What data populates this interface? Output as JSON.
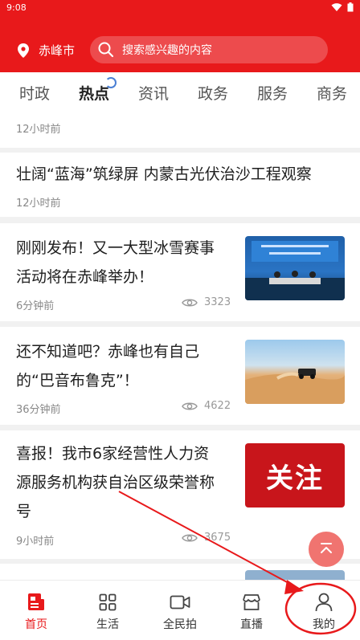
{
  "status_bar": {
    "time": "9:08"
  },
  "header": {
    "city": "赤峰市",
    "search_placeholder": "搜索感兴趣的内容"
  },
  "tabs": [
    {
      "label": "时政"
    },
    {
      "label": "热点"
    },
    {
      "label": "资讯"
    },
    {
      "label": "政务"
    },
    {
      "label": "服务"
    },
    {
      "label": "商务"
    }
  ],
  "active_tab": "热点",
  "feed": [
    {
      "title": "",
      "time": "12小时前"
    },
    {
      "title": "壮阔“蓝海”筑绿屏 内蒙古光伏治沙工程观察",
      "time": "12小时前"
    },
    {
      "title_line1": "刚刚发布！又一大型冰雪赛事",
      "title_line2": "活动将在赤峰举办！",
      "time": "6分钟前",
      "views": "3323",
      "image": "conference-photo"
    },
    {
      "title_line1": "还不知道吧？赤峰也有自己",
      "title_line2": "的“巴音布鲁克”！",
      "time": "36分钟前",
      "views": "4622",
      "image": "desert-offroad-photo"
    },
    {
      "title_line1": "喜报！我市6家经营性人力资",
      "title_line2": "源服务机构获自治区级荣誉称",
      "title_line3": "号",
      "time": "9小时前",
      "views": "3675",
      "image_text": "关注"
    }
  ],
  "bottom_nav": [
    {
      "label": "首页",
      "icon": "home-news-icon",
      "active": true
    },
    {
      "label": "生活",
      "icon": "grid-icon"
    },
    {
      "label": "全民拍",
      "icon": "video-camera-icon"
    },
    {
      "label": "直播",
      "icon": "store-icon"
    },
    {
      "label": "我的",
      "icon": "person-icon"
    }
  ],
  "colors": {
    "brand_red": "#e8191b",
    "fab": "#f07470",
    "annotation": "#e8191b"
  }
}
